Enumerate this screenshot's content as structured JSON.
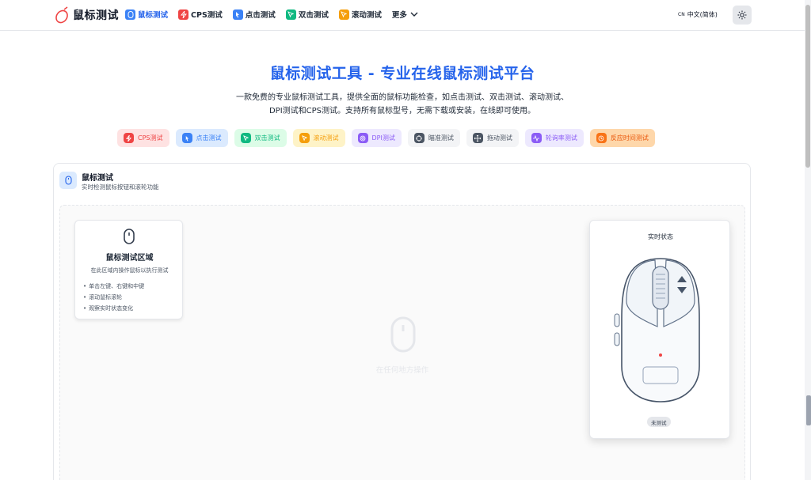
{
  "header": {
    "logo_text": "鼠标测试",
    "nav": [
      {
        "label": "鼠标测试",
        "icon": "mouse-icon",
        "color": "#3b82f6",
        "active": true
      },
      {
        "label": "CPS测试",
        "icon": "zap-icon",
        "color": "#ef4444",
        "active": false
      },
      {
        "label": "点击测试",
        "icon": "pointer-icon",
        "color": "#3b82f6",
        "active": false
      },
      {
        "label": "双击测试",
        "icon": "cursor-icon",
        "color": "#10b981",
        "active": false
      },
      {
        "label": "滚动测试",
        "icon": "cursor-icon",
        "color": "#f59e0b",
        "active": false
      }
    ],
    "more_label": "更多",
    "lang_flag": "CN",
    "lang_label": "中文(简体)"
  },
  "hero": {
    "title": "鼠标测试工具 - 专业在线鼠标测试平台",
    "desc_line1": "一款免费的专业鼠标测试工具，提供全面的鼠标功能检查，如点击测试、双击测试、滚动测试、",
    "desc_line2": "DPI测试和CPS测试。支持所有鼠标型号，无需下载或安装，在线即可使用。"
  },
  "chips": [
    {
      "label": "CPS测试",
      "bg": "#fee2e2",
      "fg": "#ef4444",
      "icon_bg": "#ef4444",
      "icon": "zap-icon"
    },
    {
      "label": "点击测试",
      "bg": "#dbeafe",
      "fg": "#3b82f6",
      "icon_bg": "#3b82f6",
      "icon": "pointer-icon"
    },
    {
      "label": "双击测试",
      "bg": "#dcfce7",
      "fg": "#10b981",
      "icon_bg": "#10b981",
      "icon": "cursor-icon"
    },
    {
      "label": "滚动测试",
      "bg": "#fef3c7",
      "fg": "#f59e0b",
      "icon_bg": "#f59e0b",
      "icon": "cursor-icon"
    },
    {
      "label": "DPI测试",
      "bg": "#ede9fe",
      "fg": "#8b5cf6",
      "icon_bg": "#8b5cf6",
      "icon": "target-icon"
    },
    {
      "label": "瞄准测试",
      "bg": "#f3f4f6",
      "fg": "#4b5563",
      "icon_bg": "#4b5563",
      "icon": "crosshair-icon"
    },
    {
      "label": "拖动测试",
      "bg": "#f3f4f6",
      "fg": "#4b5563",
      "icon_bg": "#4b5563",
      "icon": "move-icon"
    },
    {
      "label": "轮询率测试",
      "bg": "#ede9fe",
      "fg": "#8b5cf6",
      "icon_bg": "#8b5cf6",
      "icon": "activity-icon"
    },
    {
      "label": "反应时间测试",
      "bg": "#fed7aa",
      "fg": "#ea580c",
      "icon_bg": "#f97316",
      "icon": "clock-icon"
    }
  ],
  "card": {
    "title": "鼠标测试",
    "subtitle": "实时检测鼠标按钮和滚轮功能"
  },
  "info_box": {
    "title": "鼠标测试区域",
    "subtitle": "在此区域内操作鼠标以执行测试",
    "items": [
      "单击左键、右键和中键",
      "滚动鼠标滚轮",
      "观察实时状态变化"
    ]
  },
  "ghost_text": "在任何地方操作",
  "status_panel": {
    "title": "实时状态",
    "badge": "未测试"
  }
}
